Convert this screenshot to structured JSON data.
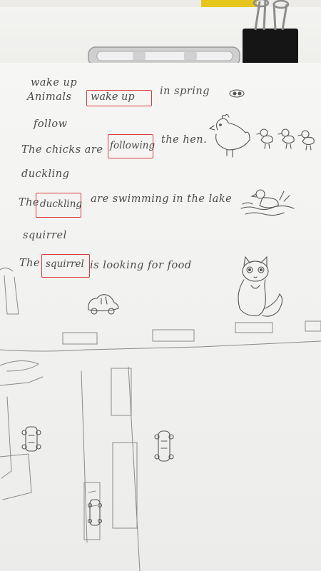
{
  "worksheet": {
    "lines": [
      {
        "id": "word-1",
        "text": "wake  up"
      },
      {
        "id": "sentence-1-start",
        "text": "Animals"
      },
      {
        "id": "sentence-1-box",
        "text": "wake    up"
      },
      {
        "id": "sentence-1-end",
        "text": "in  spring"
      },
      {
        "id": "word-2",
        "text": "follow"
      },
      {
        "id": "sentence-2-start",
        "text": "The  chicks  are"
      },
      {
        "id": "sentence-2-box",
        "text": "following"
      },
      {
        "id": "sentence-2-end",
        "text": "the hen."
      },
      {
        "id": "word-3",
        "text": "duckling"
      },
      {
        "id": "sentence-3-start",
        "text": "The"
      },
      {
        "id": "sentence-3-box",
        "text": "duckling"
      },
      {
        "id": "sentence-3-end",
        "text": "are  swimming  in  the lake"
      },
      {
        "id": "word-4",
        "text": "squirrel"
      },
      {
        "id": "sentence-4-start",
        "text": "The"
      },
      {
        "id": "sentence-4-box",
        "text": "squirrel"
      },
      {
        "id": "sentence-4-end",
        "text": "is  looking  for  food"
      }
    ]
  },
  "colors": {
    "pencil": "#4a4a4a",
    "red_box": "#d93b3b",
    "clip": "#1b1b1b",
    "bar": "#bfbfbf"
  }
}
